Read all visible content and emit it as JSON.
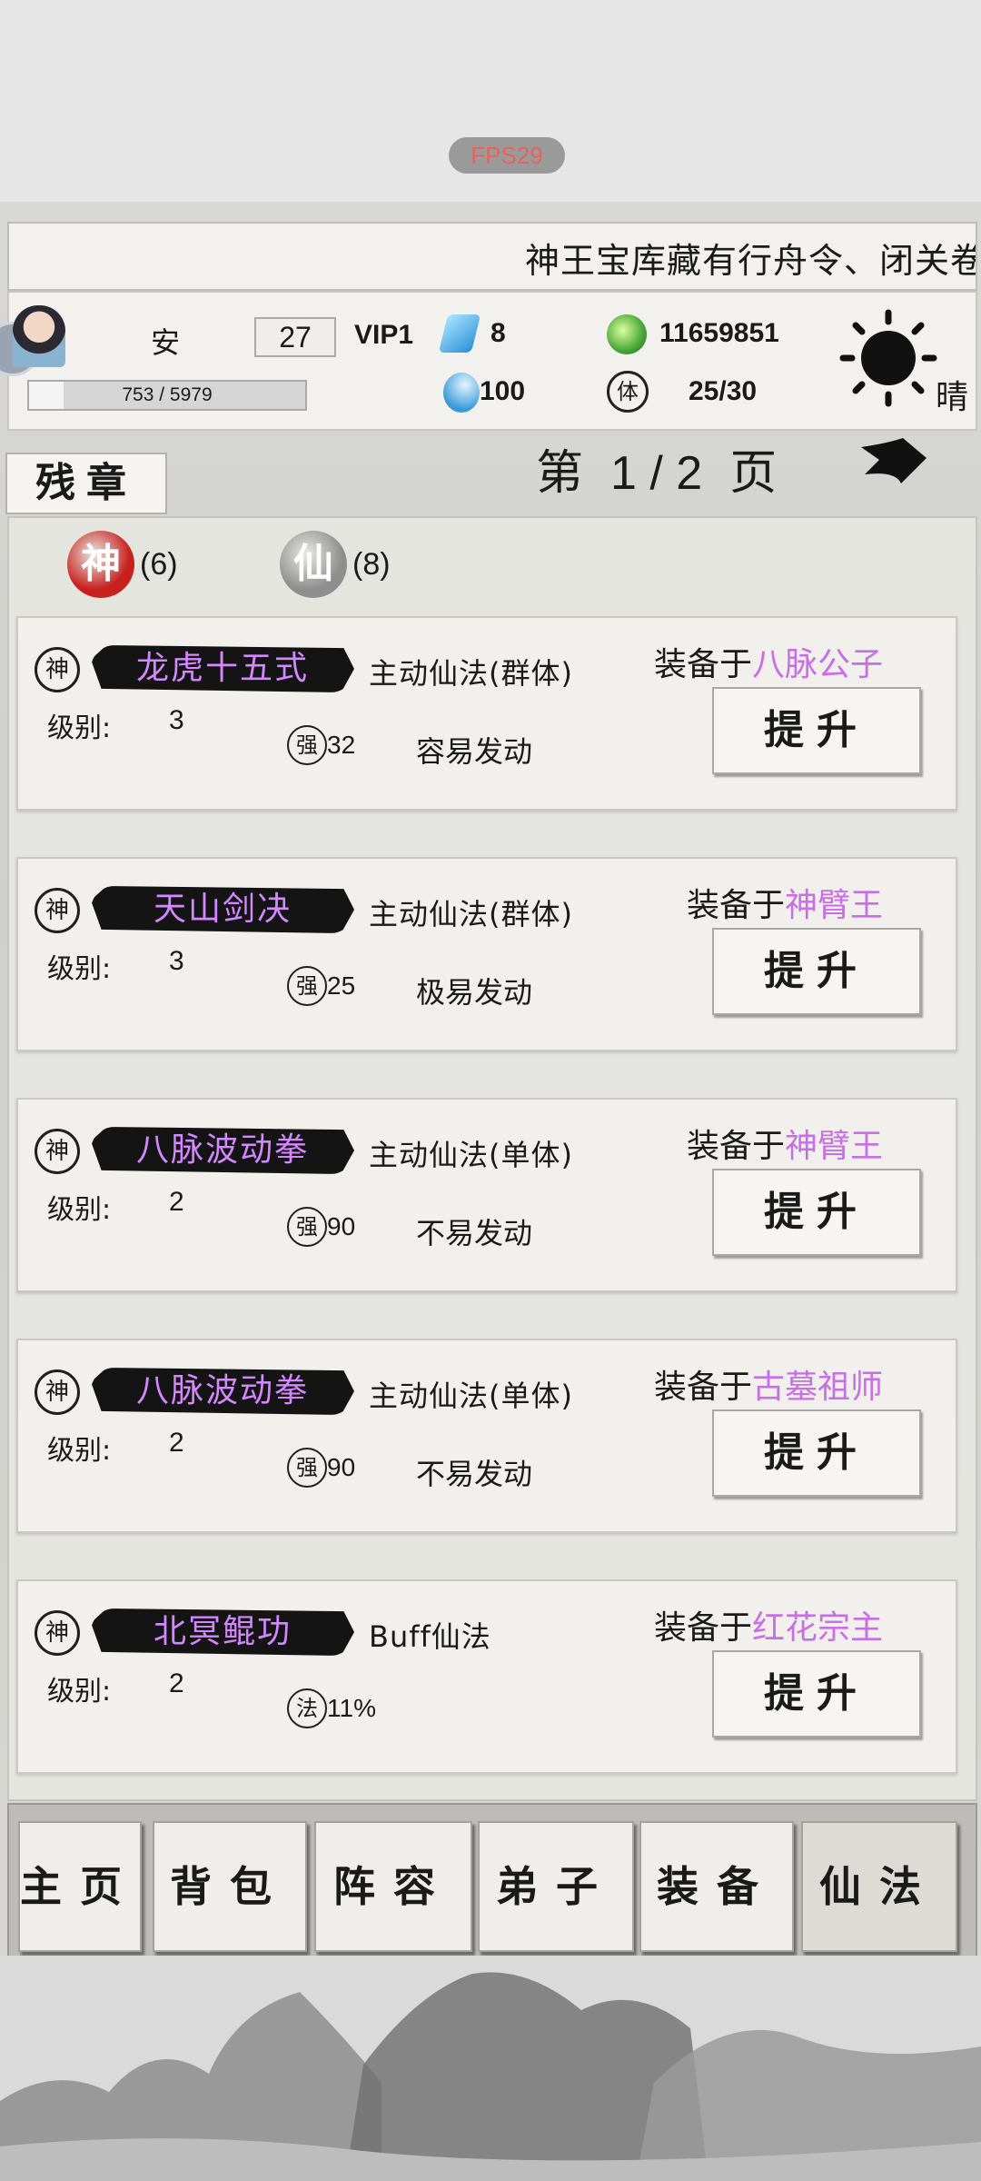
{
  "fps": "FPS29",
  "marquee": "神王宝库藏有行舟令、闭关卷",
  "player": {
    "name": "安",
    "level": "27",
    "vip": "VIP1",
    "exp": "753 / 5979",
    "exp_progress": 0.126,
    "gems": "8",
    "coins": "11659851",
    "souls": "100",
    "stamina_icon": "体",
    "stamina": "25/30",
    "weather": "晴"
  },
  "section_tab": "残章",
  "pager": {
    "prefix": "第",
    "page": "1 / 2",
    "suffix": "页"
  },
  "filters": [
    {
      "glyph": "神",
      "count": "(6)",
      "color": "#c8201e"
    },
    {
      "glyph": "仙",
      "count": "(8)",
      "color": "#8e8e8e"
    }
  ],
  "equip_prefix": "装备于",
  "level_label": "级别:",
  "upgrade_label": "提升",
  "skills": [
    {
      "grade": "神",
      "name": "龙虎十五式",
      "type": "主动仙法(群体)",
      "level": "3",
      "stat_icon": "强",
      "stat": "32",
      "trigger": "容易发动",
      "equipped_to": "八脉公子"
    },
    {
      "grade": "神",
      "name": "天山剑决",
      "type": "主动仙法(群体)",
      "level": "3",
      "stat_icon": "强",
      "stat": "25",
      "trigger": "极易发动",
      "equipped_to": "神臂王"
    },
    {
      "grade": "神",
      "name": "八脉波动拳",
      "type": "主动仙法(单体)",
      "level": "2",
      "stat_icon": "强",
      "stat": "90",
      "trigger": "不易发动",
      "equipped_to": "神臂王"
    },
    {
      "grade": "神",
      "name": "八脉波动拳",
      "type": "主动仙法(单体)",
      "level": "2",
      "stat_icon": "强",
      "stat": "90",
      "trigger": "不易发动",
      "equipped_to": "古墓祖师"
    },
    {
      "grade": "神",
      "name": "北冥鲲功",
      "type": "Buff仙法",
      "level": "2",
      "stat_icon": "法",
      "stat": "11%",
      "trigger": "",
      "equipped_to": "红花宗主"
    }
  ],
  "nav": [
    "主页",
    "背包",
    "阵容",
    "弟子",
    "装备",
    "仙法"
  ],
  "nav_active": "仙法"
}
